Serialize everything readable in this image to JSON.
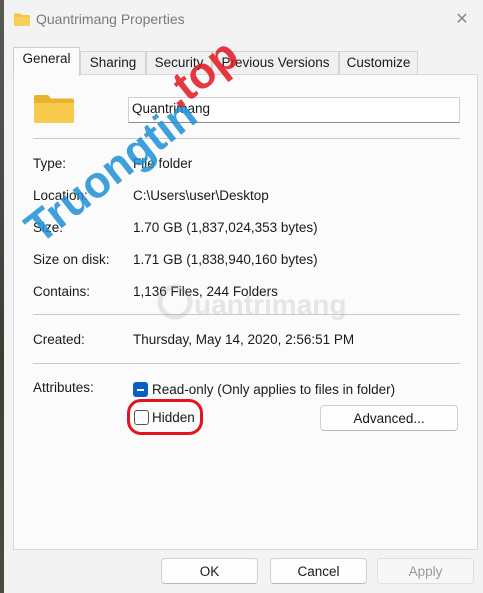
{
  "window": {
    "title": "Quantrimang Properties"
  },
  "tabs": [
    {
      "label": "General"
    },
    {
      "label": "Sharing"
    },
    {
      "label": "Security"
    },
    {
      "label": "Previous Versions"
    },
    {
      "label": "Customize"
    }
  ],
  "name_field": {
    "value": "Quantrimang"
  },
  "props": {
    "type_label": "Type:",
    "type_value": "File folder",
    "location_label": "Location:",
    "location_value": "C:\\Users\\user\\Desktop",
    "size_label": "Size:",
    "size_value": "1.70 GB (1,837,024,353 bytes)",
    "disk_label": "Size on disk:",
    "disk_value": "1.71 GB (1,838,940,160 bytes)",
    "contains_label": "Contains:",
    "contains_value": "1,136 Files, 244 Folders",
    "created_label": "Created:",
    "created_value": "Thursday, May 14, 2020, 2:56:51 PM"
  },
  "attributes": {
    "label": "Attributes:",
    "readonly_label": "Read-only (Only applies to files in folder)",
    "readonly_state": "indeterminate",
    "hidden_label": "Hidden",
    "hidden_checked": false,
    "advanced_label": "Advanced..."
  },
  "footer": {
    "ok": "OK",
    "cancel": "Cancel",
    "apply": "Apply"
  },
  "watermark": {
    "brand_main": "Truongtin",
    "brand_tld": ".top",
    "brand_secondary": "uantrimang"
  },
  "colors": {
    "accent": "#0a5ec6",
    "highlight": "#e3141e",
    "folder": "#f5c242",
    "watermark": "#1e8fd6"
  }
}
